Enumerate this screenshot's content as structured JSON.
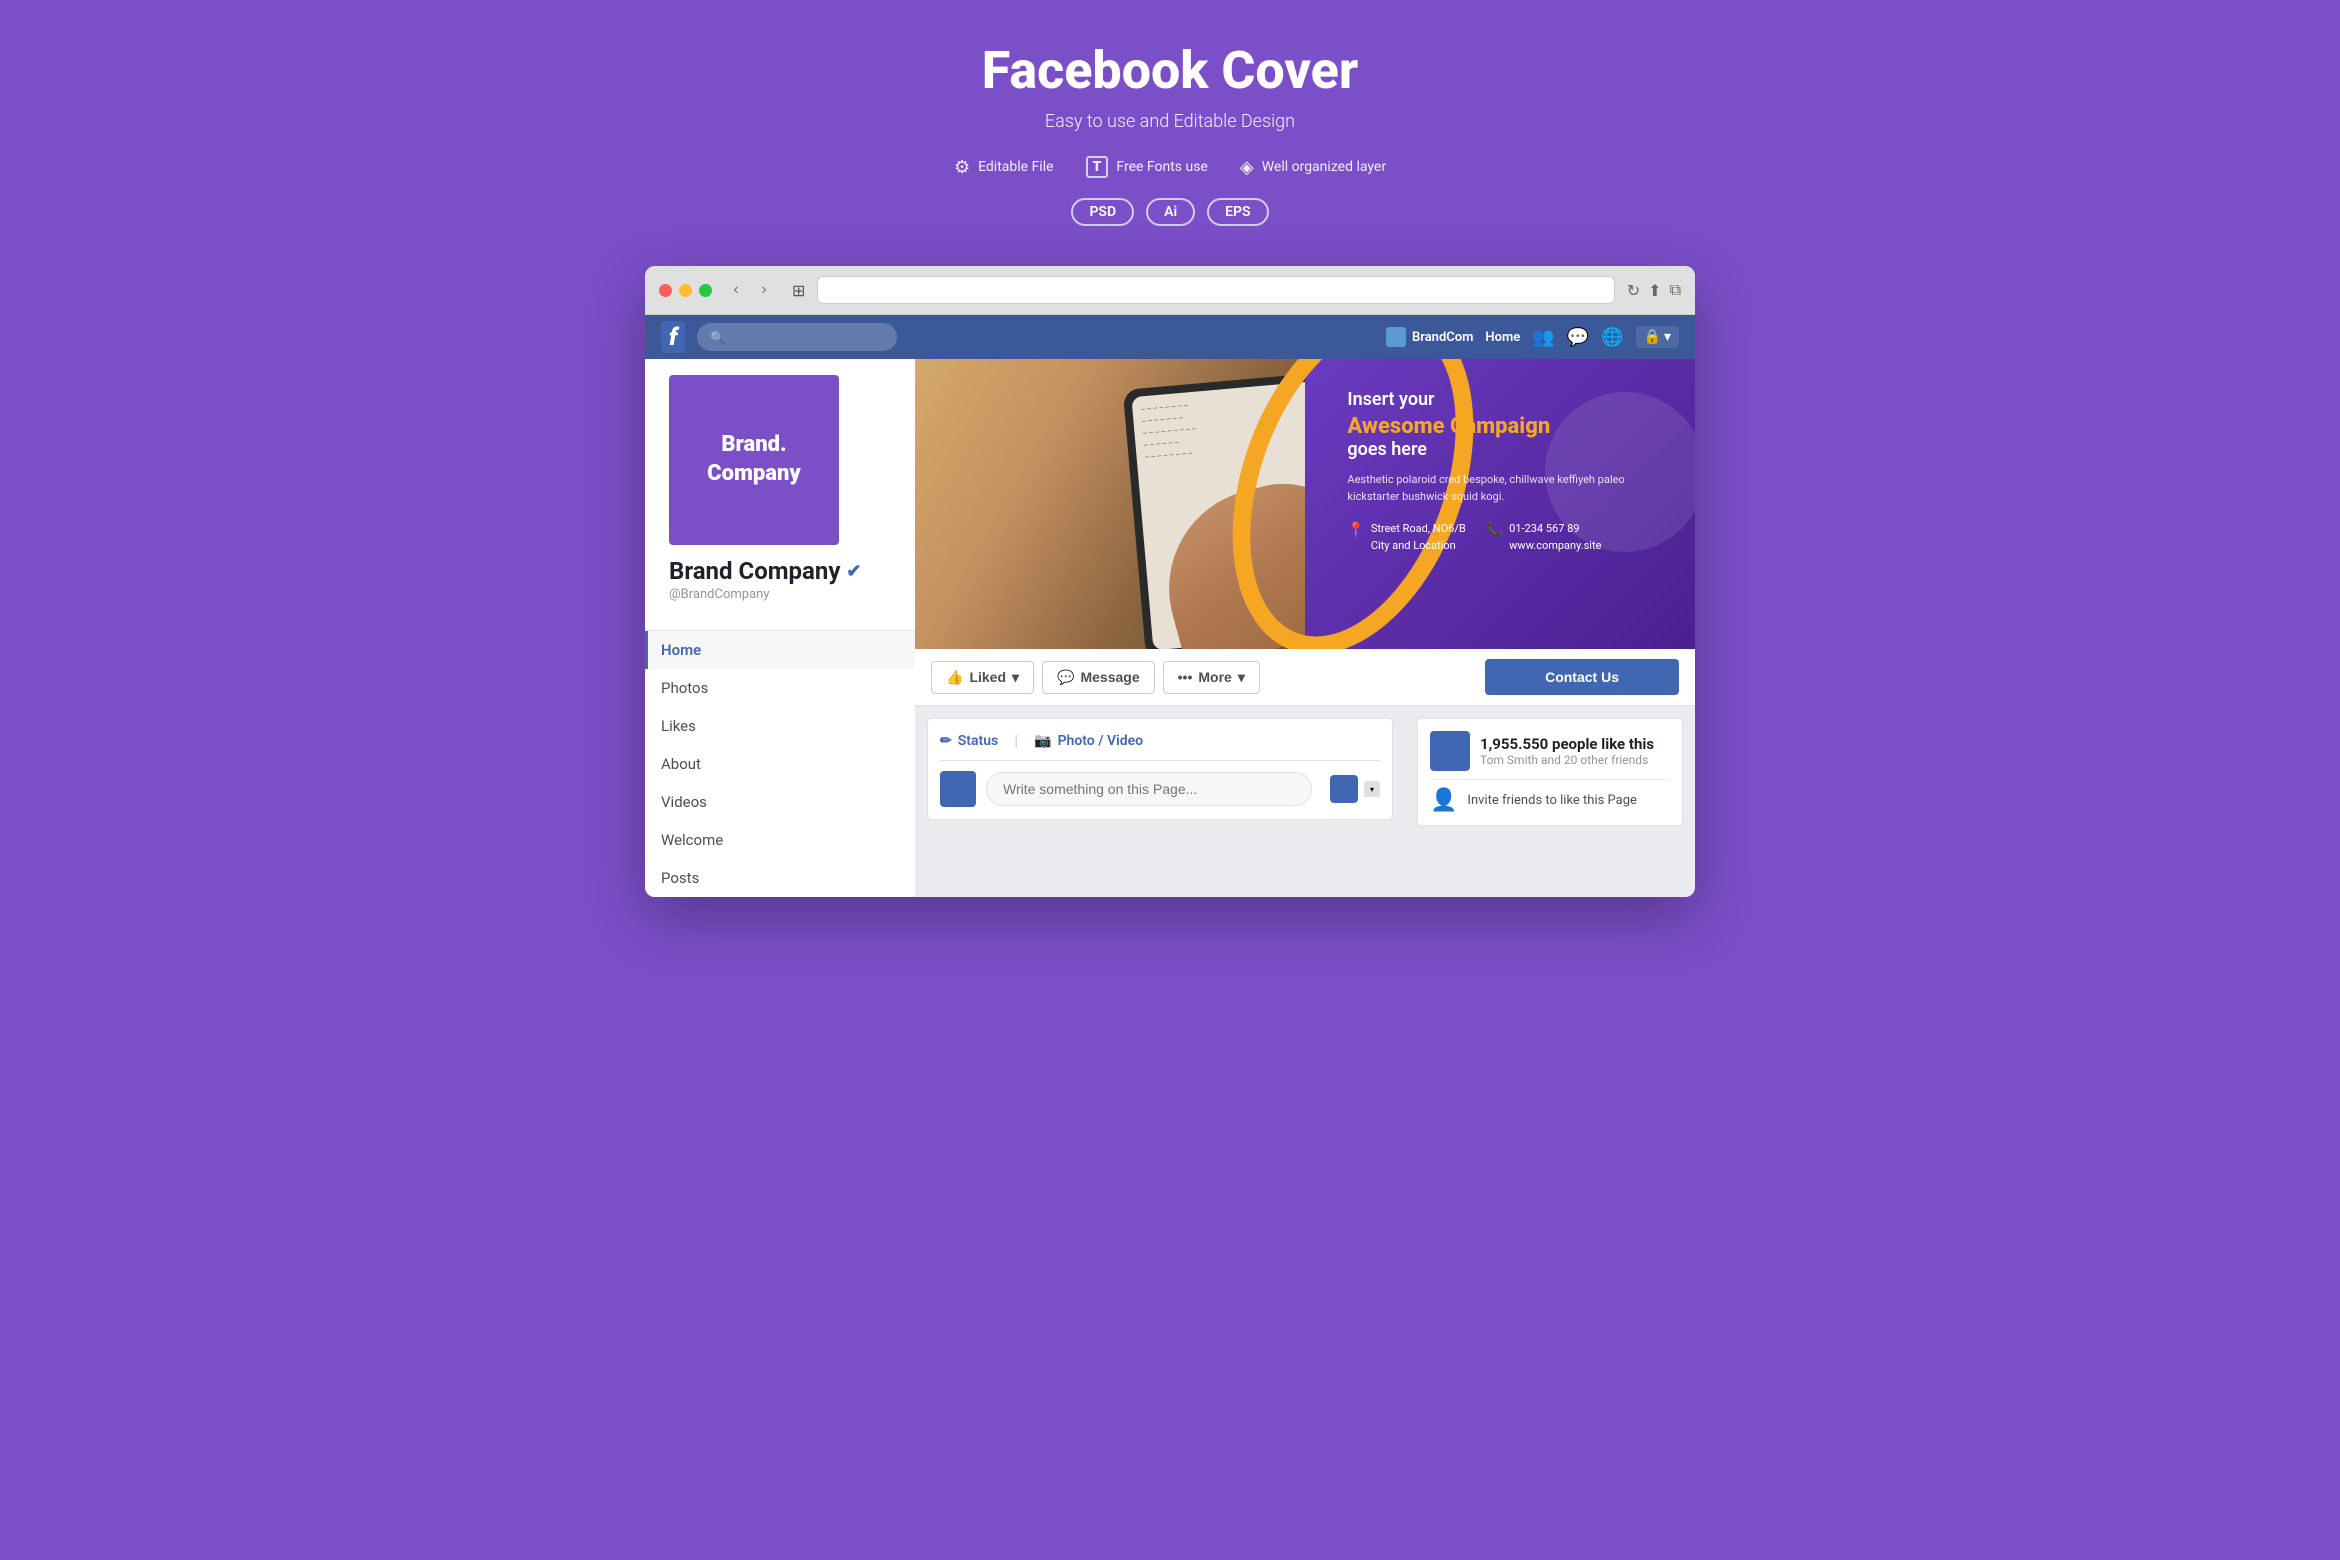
{
  "header": {
    "title": "Facebook Cover",
    "subtitle": "Easy to use and Editable Design",
    "features": [
      {
        "icon": "⚙",
        "label": "Editable File"
      },
      {
        "icon": "T",
        "label": "Free Fonts use"
      },
      {
        "icon": "◈",
        "label": "Well organized layer"
      }
    ],
    "badges": [
      "PSD",
      "Ai",
      "EPS"
    ]
  },
  "browser": {
    "address_placeholder": ""
  },
  "facebook": {
    "navbar": {
      "brand_color_label": "BrandCom",
      "home_label": "Home",
      "search_placeholder": "🔍"
    },
    "profile": {
      "avatar_line1": "Brand.",
      "avatar_line2": "Company",
      "name": "Brand Company",
      "handle": "@BrandCompany"
    },
    "nav_items": [
      {
        "label": "Home",
        "active": true
      },
      {
        "label": "Photos",
        "active": false
      },
      {
        "label": "Likes",
        "active": false
      },
      {
        "label": "About",
        "active": false
      },
      {
        "label": "Videos",
        "active": false
      },
      {
        "label": "Welcome",
        "active": false
      },
      {
        "label": "Posts",
        "active": false
      }
    ],
    "cover": {
      "headline": "Insert your",
      "highlight": "Awesome Campaign",
      "subline": "goes here",
      "description": "Aesthetic polaroid cred bespoke, chillwave keffiyeh paleo kickstarter bushwick squid kogi.",
      "address_label": "Street Road, NO6/B",
      "address_sub": "City and Location",
      "phone": "01-234 567 89",
      "website": "www.company.site"
    },
    "actions": {
      "liked": "Liked",
      "message": "Message",
      "more": "More",
      "contact_us": "Contact Us"
    },
    "post": {
      "status_label": "Status",
      "photo_video_label": "Photo / Video",
      "placeholder": "Write something on this Page..."
    },
    "likes_widget": {
      "count": "1,955.550 people like this",
      "friends": "Tom Smith and 20 other friends",
      "invite_text": "Invite friends to like this Page"
    }
  }
}
